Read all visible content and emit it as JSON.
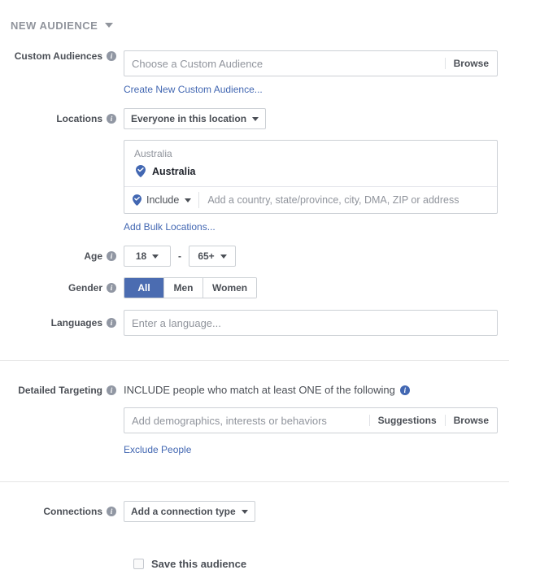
{
  "header": {
    "title": "NEW AUDIENCE",
    "caret_icon": "chevron-down-icon"
  },
  "custom_audiences": {
    "label": "Custom Audiences",
    "placeholder": "Choose a Custom Audience",
    "browse_label": "Browse",
    "create_link": "Create New Custom Audience..."
  },
  "locations": {
    "label": "Locations",
    "scope_label": "Everyone in this location",
    "group_title": "Australia",
    "selected": [
      {
        "name": "Australia",
        "icon": "map-pin-check-icon"
      }
    ],
    "include_label": "Include",
    "input_placeholder": "Add a country, state/province, city, DMA, ZIP or address",
    "bulk_link": "Add Bulk Locations..."
  },
  "age": {
    "label": "Age",
    "min": "18",
    "max": "65+",
    "separator": "-"
  },
  "gender": {
    "label": "Gender",
    "options": [
      {
        "label": "All",
        "selected": true
      },
      {
        "label": "Men",
        "selected": false
      },
      {
        "label": "Women",
        "selected": false
      }
    ]
  },
  "languages": {
    "label": "Languages",
    "placeholder": "Enter a language..."
  },
  "detailed_targeting": {
    "label": "Detailed Targeting",
    "heading": "INCLUDE people who match at least ONE of the following",
    "placeholder": "Add demographics, interests or behaviors",
    "suggestions_label": "Suggestions",
    "browse_label": "Browse",
    "exclude_link": "Exclude People"
  },
  "connections": {
    "label": "Connections",
    "button_label": "Add a connection type"
  },
  "save_audience": {
    "label": "Save this audience",
    "checked": false
  },
  "colors": {
    "accent": "#4267b2",
    "segment_active": "#4b6cb1",
    "label_text": "#4b4f56",
    "placeholder_text": "#90949c",
    "border": "#ccd0d5",
    "divider": "#e5e5e5"
  }
}
